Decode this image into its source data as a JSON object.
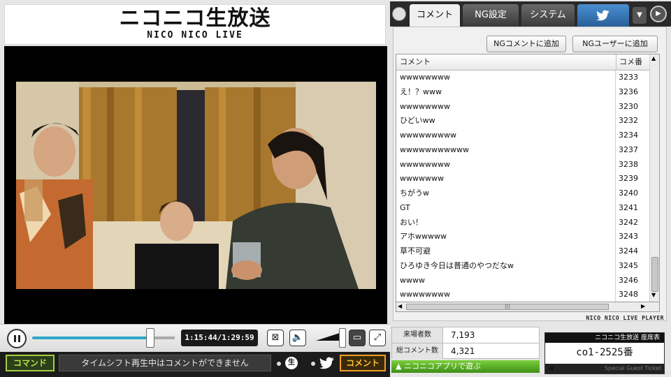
{
  "logo": {
    "main": "ニコニコ生放送",
    "sub": "NICO NICO LIVE"
  },
  "player": {
    "time": "1:15:44/1:29:59",
    "progress": 0.84
  },
  "command_bar": {
    "command_label": "コマンド",
    "input_message": "タイムシフト再生中はコメントができません",
    "nama_glyph": "生",
    "submit_label": "コメント"
  },
  "tabs": [
    {
      "label": "コメント",
      "active": true
    },
    {
      "label": "NG設定",
      "active": false
    },
    {
      "label": "システム",
      "active": false
    }
  ],
  "ng_buttons": {
    "add_comment": "NGコメントに追加",
    "add_user": "NGユーザーに追加"
  },
  "comment_table": {
    "headers": {
      "comment": "コメント",
      "number": "コメ番"
    },
    "rows": [
      {
        "text": "wwwwwwww",
        "no": "3233"
      },
      {
        "text": "え！？www",
        "no": "3236"
      },
      {
        "text": "wwwwwwww",
        "no": "3230"
      },
      {
        "text": "ひどいww",
        "no": "3232"
      },
      {
        "text": "wwwwwwwww",
        "no": "3234"
      },
      {
        "text": "wwwwwwwwwww",
        "no": "3237"
      },
      {
        "text": "wwwwwwww",
        "no": "3238"
      },
      {
        "text": "wwwwwww",
        "no": "3239"
      },
      {
        "text": "ちがうw",
        "no": "3240"
      },
      {
        "text": "GT",
        "no": "3241"
      },
      {
        "text": "おい！",
        "no": "3242"
      },
      {
        "text": "アホwwwww",
        "no": "3243"
      },
      {
        "text": "草不可避",
        "no": "3244"
      },
      {
        "text": "ひろゆき今日は普通のやつだなw",
        "no": "3245"
      },
      {
        "text": "wwww",
        "no": "3246"
      },
      {
        "text": "wwwwwwww",
        "no": "3248"
      }
    ]
  },
  "player_logo": "NICO NICO LIVE PLAYER",
  "stats": {
    "visitors_label": "来場者数",
    "visitors_value": "7,193",
    "comments_label": "総コメント数",
    "comments_value": "4,321"
  },
  "app_link": "▲ ニコニコアプリで遊ぶ",
  "ticket": {
    "header": "ニコニコ生放送 座席表",
    "seat": "co1-2525番",
    "footer": "Special Guest Ticket"
  },
  "colors": {
    "accent_blue": "#2fa7c9",
    "command_green": "#a6cf42",
    "submit_orange": "#f0a020",
    "app_green": "#4fa81f"
  }
}
